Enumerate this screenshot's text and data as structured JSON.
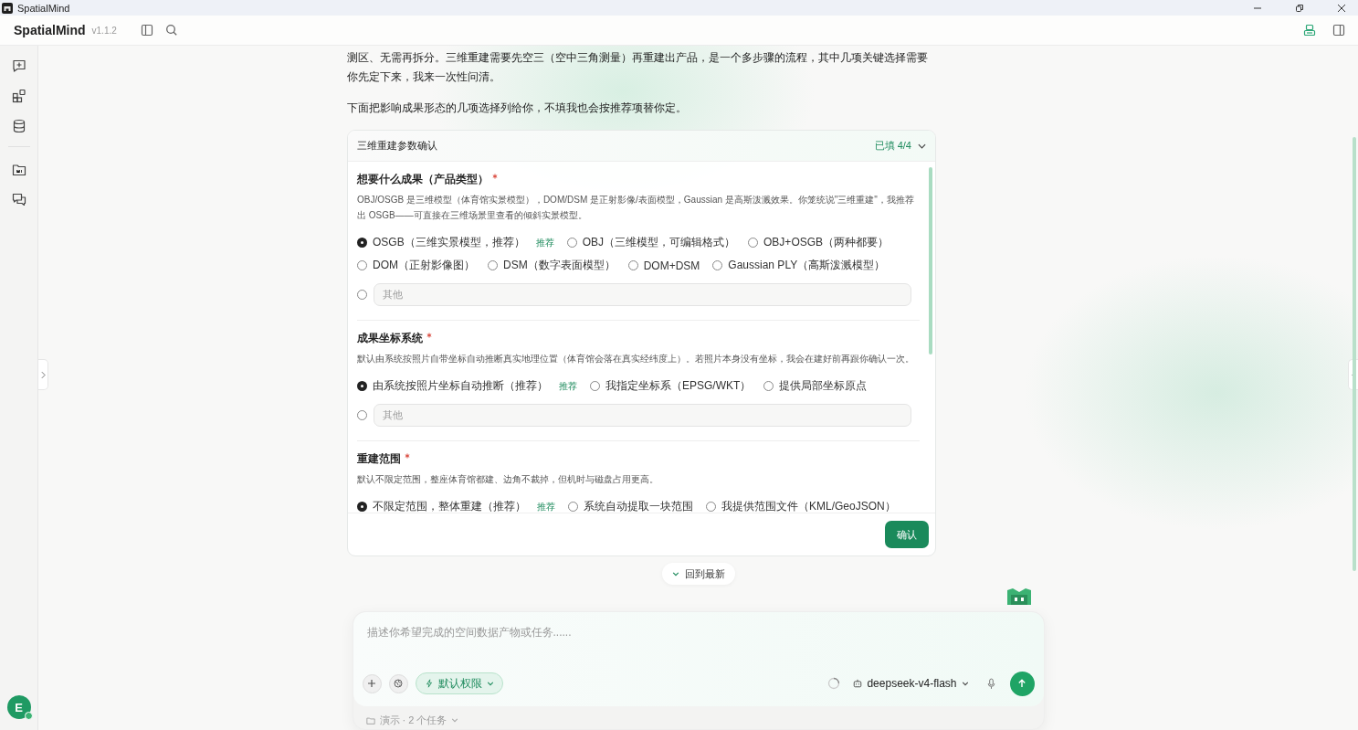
{
  "window": {
    "title": "SpatialMind"
  },
  "header": {
    "app_name": "SpatialMind",
    "version": "v1.1.2"
  },
  "chat": {
    "paragraphs": [
      "测区、无需再拆分。三维重建需要先空三（空中三角测量）再重建出产品，是一个多步骤的流程，其中几项关键选择需要你先定下来，我来一次性问清。",
      "下面把影响成果形态的几项选择列给你，不填我也会按推荐项替你定。"
    ],
    "form": {
      "title": "三维重建参数确认",
      "status": "已填 4/4",
      "expanded": true,
      "confirm_label": "确认",
      "questions": [
        {
          "title": "想要什么成果（产品类型）",
          "required": true,
          "description": "OBJ/OSGB 是三维模型（体育馆实景模型），DOM/DSM 是正射影像/表面模型，Gaussian 是高斯泼溅效果。你笼统说\"三维重建\"，我推荐出 OSGB——可直接在三维场景里查看的倾斜实景模型。",
          "option_rows": [
            [
              {
                "label": "OSGB（三维实景模型，推荐）",
                "tag": "推荐",
                "selected": true
              },
              {
                "label": "OBJ（三维模型，可编辑格式）",
                "selected": false
              },
              {
                "label": "OBJ+OSGB（两种都要）",
                "selected": false
              }
            ],
            [
              {
                "label": "DOM（正射影像图）",
                "selected": false
              },
              {
                "label": "DSM（数字表面模型）",
                "selected": false
              },
              {
                "label": "DOM+DSM",
                "selected": false
              },
              {
                "label": "Gaussian PLY（高斯泼溅模型）",
                "selected": false
              }
            ]
          ],
          "other": {
            "placeholder": "其他",
            "selected": false
          }
        },
        {
          "title": "成果坐标系统",
          "required": true,
          "description": "默认由系统按照片自带坐标自动推断真实地理位置（体育馆会落在真实经纬度上）。若照片本身没有坐标，我会在建好前再跟你确认一次。",
          "option_rows": [
            [
              {
                "label": "由系统按照片坐标自动推断（推荐）",
                "tag": "推荐",
                "selected": true
              },
              {
                "label": "我指定坐标系（EPSG/WKT）",
                "selected": false
              },
              {
                "label": "提供局部坐标原点",
                "selected": false
              }
            ]
          ],
          "other": {
            "placeholder": "其他",
            "selected": false
          }
        },
        {
          "title": "重建范围",
          "required": true,
          "description": "默认不限定范围，整座体育馆都建、边角不裁掉，但机时与磁盘占用更高。",
          "option_rows": [
            [
              {
                "label": "不限定范围，整体重建（推荐）",
                "tag": "推荐",
                "selected": true
              },
              {
                "label": "系统自动提取一块范围",
                "selected": false
              },
              {
                "label": "我提供范围文件（KML/GeoJSON）",
                "selected": false
              }
            ]
          ]
        }
      ]
    },
    "jump_latest": "回到最新"
  },
  "composer": {
    "placeholder": "描述你希望完成的空间数据产物或任务......",
    "permission": "默认权限",
    "model": "deepseek-v4-flash",
    "project": "演示 · 2 个任务"
  },
  "user": {
    "initial": "E",
    "online": true
  }
}
